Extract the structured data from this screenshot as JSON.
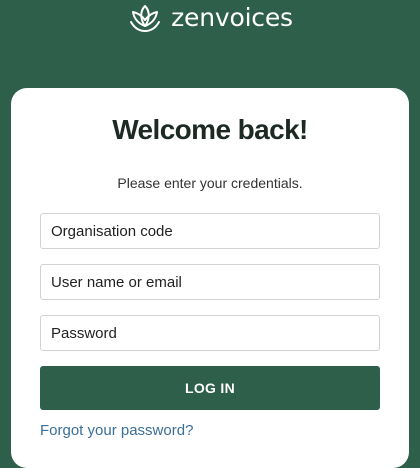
{
  "brand": {
    "name": "zenvoices",
    "logo_icon": "lotus-icon"
  },
  "login": {
    "title": "Welcome back!",
    "subtitle": "Please enter your credentials.",
    "organisation_placeholder": "Organisation code",
    "username_placeholder": "User name or email",
    "password_placeholder": "Password",
    "submit_label": "LOG IN",
    "forgot_label": "Forgot your password?"
  },
  "colors": {
    "brand_green": "#2e5f4a",
    "link_blue": "#3a6f96"
  }
}
